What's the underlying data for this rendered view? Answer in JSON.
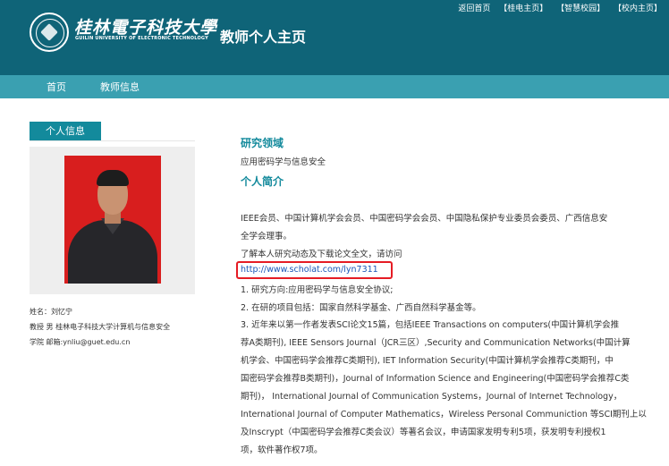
{
  "header": {
    "top_links": [
      "返回首页",
      "【桂电主页】",
      "【智慧校园】",
      "【校内主页】"
    ],
    "logo_cn": "桂林電子科技大學",
    "logo_en": "GUILIN UNIVERSITY OF ELECTRONIC TECHNOLOGY",
    "site_title": "教师个人主页"
  },
  "nav": {
    "items": [
      "首页",
      "教师信息"
    ]
  },
  "sidebar": {
    "tab_label": "个人信息",
    "info_lines": [
      "姓名：刘忆宁",
      "教授 男 桂林电子科技大学计算机与信息安全",
      "学院 邮箱:ynliu@guet.edu.cn"
    ]
  },
  "main": {
    "research_heading": "研究领域",
    "research_text": "应用密码学与信息安全",
    "intro_heading": "个人简介",
    "lines": [
      "IEEE会员、中国计算机学会会员、中国密码学会会员、中国隐私保护专业委员会委员、广西信息安",
      "全学会理事。",
      "了解本人研究动态及下载论文全文，请访问",
      "http://www.scholat.com/lyn7311",
      "1. 研究方向:应用密码学与信息安全协议;",
      "2. 在研的项目包括：国家自然科学基金、广西自然科学基金等。",
      "3. 近年来以第一作者发表SCI论文15篇，包括IEEE Transactions on computers(中国计算机学会推",
      "荐A类期刊), IEEE Sensors Journal（JCR三区）,Security and Communication Networks(中国计算",
      "机学会、中国密码学会推荐C类期刊), IET Information Security(中国计算机学会推荐C类期刊，中",
      "国密码学会推荐B类期刊)，Journal of Information Science and Engineering(中国密码学会推荐C类",
      "期刊)，  International Journal of Communication Systems，Journal of Internet Technology，",
      "International Journal of Computer Mathematics，Wireless Personal Communiction 等SCI期刊上以",
      "及Inscrypt（中国密码学会推荐C类会议）等著名会议，申请国家发明专利5项，获发明专利授权1",
      "项，软件著作权7项。"
    ]
  },
  "colors": {
    "header_bg": "#0f6478",
    "nav_bg": "#3aa0b1",
    "accent": "#138a9c",
    "link": "#1a57b8",
    "highlight": "#e51c24"
  }
}
